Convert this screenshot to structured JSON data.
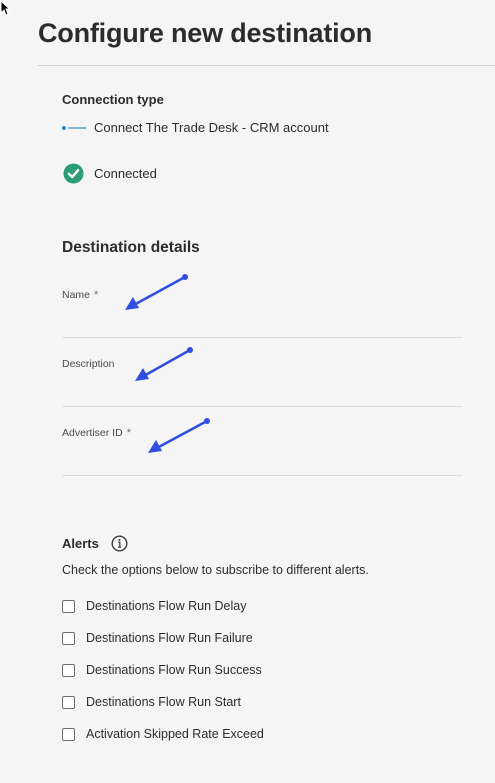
{
  "page": {
    "title": "Configure new destination"
  },
  "connection": {
    "heading": "Connection type",
    "name": "Connect The Trade Desk - CRM account",
    "logo_icon": "trade-desk-logo-icon",
    "status": "Connected",
    "status_icon": "checkmark-circle-icon",
    "status_color": "#2d9d78"
  },
  "destination": {
    "heading": "Destination details",
    "fields": [
      {
        "label": "Name",
        "required": "*",
        "value": ""
      },
      {
        "label": "Description",
        "required": "",
        "value": ""
      },
      {
        "label": "Advertiser ID",
        "required": "*",
        "value": ""
      }
    ],
    "annotation_color": "#2f4ee0"
  },
  "alerts": {
    "heading": "Alerts",
    "info_icon": "info-icon",
    "description": "Check the options below to subscribe to different alerts.",
    "options": [
      {
        "label": "Destinations Flow Run Delay",
        "checked": false
      },
      {
        "label": "Destinations Flow Run Failure",
        "checked": false
      },
      {
        "label": "Destinations Flow Run Success",
        "checked": false
      },
      {
        "label": "Destinations Flow Run Start",
        "checked": false
      },
      {
        "label": "Activation Skipped Rate Exceed",
        "checked": false
      }
    ]
  }
}
